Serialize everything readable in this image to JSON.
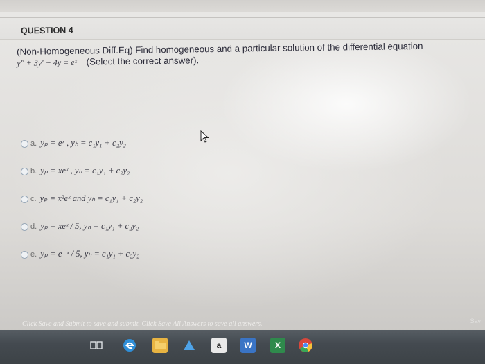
{
  "question": {
    "title": "QUESTION 4",
    "text": "(Non-Homogeneous Diff.Eq) Find homogeneous and a particular solution of the differential equation",
    "equation": "y\" + 3y' − 4y = eˣ",
    "instruction": "(Select the correct answer)."
  },
  "options": [
    {
      "letter": "a.",
      "math": "yₚ = eˣ ,  yₕ = c₁y₁ + c₂y₂"
    },
    {
      "letter": "b.",
      "math": "yₚ = xeˣ ,  yₕ = c₁y₁ + c₂y₂"
    },
    {
      "letter": "c.",
      "math": "yₚ = x²eˣ  and  yₕ = c₁y₁ + c₂y₂"
    },
    {
      "letter": "d.",
      "math": "yₚ = xeˣ / 5,  yₕ = c₁y₁ + c₂y₂"
    },
    {
      "letter": "e.",
      "math": "yₚ = e⁻ˣ / 5,  yₕ = c₁y₁ + c₂y₂"
    }
  ],
  "footer": {
    "status": "Click Save and Submit to save and submit. Click Save All Answers to save all answers.",
    "save_hint": "Sav"
  },
  "taskbar": {
    "items": [
      "task-view-icon",
      "edge-icon",
      "file-explorer-icon",
      "store-icon",
      "mail-icon",
      "amazon-icon",
      "word-icon",
      "excel-icon",
      "chrome-icon"
    ],
    "amazon_label": "a",
    "word_label": "W",
    "excel_label": "X"
  },
  "colors": {
    "taskbar": "#444a50",
    "radio_border": "#9aa9b8",
    "text": "#2c2c3a"
  }
}
